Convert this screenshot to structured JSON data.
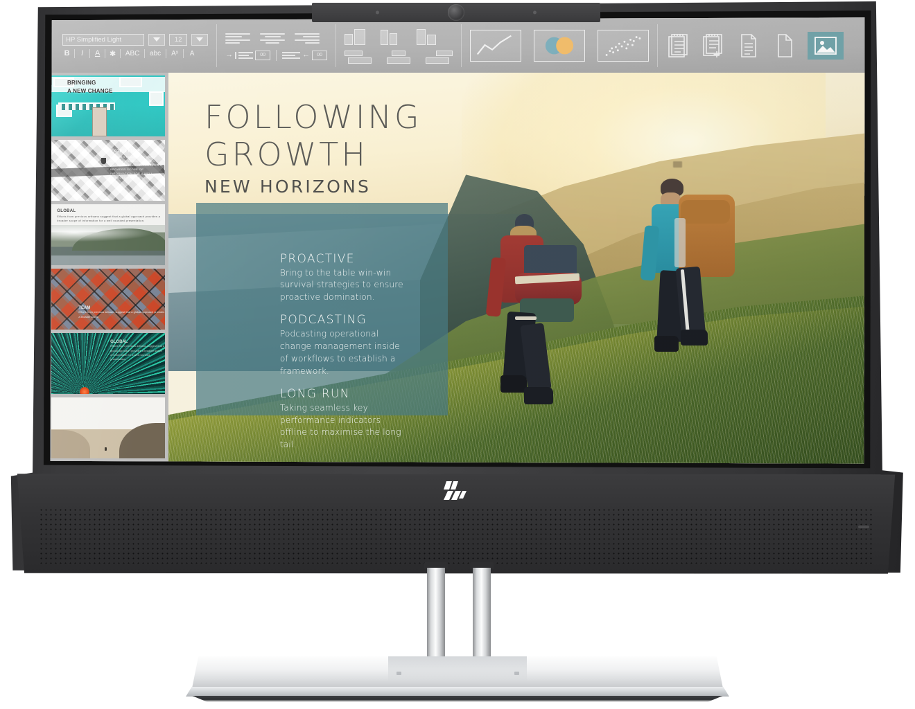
{
  "device": {
    "brand": "hp",
    "logo_name": "hp-logo",
    "webcam_name": "webcam"
  },
  "toolbar": {
    "font_name": "HP Simplified Light",
    "font_size": "12",
    "font_dropdown_label": "▼",
    "size_dropdown_label": "▼",
    "format_buttons": [
      {
        "name": "bold-button",
        "label": "B"
      },
      {
        "name": "italic-button",
        "label": "I"
      },
      {
        "name": "underline-button",
        "label": "A"
      },
      {
        "name": "text-color-button",
        "label": "A"
      }
    ],
    "case_buttons": [
      {
        "name": "uppercase-button",
        "label": "ABC"
      },
      {
        "name": "lowercase-button",
        "label": "abc"
      },
      {
        "name": "superscript-button",
        "label": "Aˣ"
      },
      {
        "name": "subscript-button",
        "label": "A"
      }
    ],
    "align_buttons": [
      {
        "name": "align-left-button",
        "label": "Align left"
      },
      {
        "name": "align-center-button",
        "label": "Align center"
      },
      {
        "name": "align-right-button",
        "label": "Align right"
      }
    ],
    "indent_buttons": [
      {
        "name": "indent-increase-button",
        "label": "Increase indent"
      },
      {
        "name": "indent-decrease-button",
        "label": "Decrease indent"
      }
    ],
    "indent_box_label": "00",
    "layout_buttons": [
      {
        "name": "layout-two-column-button",
        "label": "Two column"
      },
      {
        "name": "layout-split-button",
        "label": "Split"
      },
      {
        "name": "layout-sidebar-button",
        "label": "Sidebar"
      },
      {
        "name": "layout-caption-left-button",
        "label": "Caption left"
      },
      {
        "name": "layout-caption-center-button",
        "label": "Caption center"
      },
      {
        "name": "layout-caption-right-button",
        "label": "Caption right"
      }
    ],
    "chart_buttons": [
      {
        "name": "line-chart-button",
        "label": "Line chart"
      },
      {
        "name": "venn-chart-button",
        "label": "Venn chart"
      },
      {
        "name": "scatter-chart-button",
        "label": "Scatter chart"
      }
    ],
    "doc_buttons": [
      {
        "name": "notepad-button",
        "label": "Notepad"
      },
      {
        "name": "notepad-add-button",
        "label": "Add notepad"
      },
      {
        "name": "document-button",
        "label": "Document"
      },
      {
        "name": "blank-page-button",
        "label": "Blank page"
      }
    ],
    "image_button": {
      "name": "insert-image-button",
      "label": "Insert image",
      "active": true
    }
  },
  "colors": {
    "accent_teal": "#74a6ac",
    "panel_teal": "#487a82",
    "chart_blue": "#7fb0bd",
    "chart_orange": "#f2be6c",
    "toolbar_gray": "#b3b3b3",
    "headline_gray": "#5b5b57",
    "slide_cream": "#f6f1de"
  },
  "sidebar": {
    "thumbnails": [
      {
        "name": "slide-thumbnail-1",
        "title_line1": "BRINGING",
        "title_line2": "A NEW CHANGE",
        "theme": "turquoise-building"
      },
      {
        "name": "slide-thumbnail-2",
        "title": "EXCELLENCE",
        "body": "Efforts from previous artisans suggest that a global approach provides a broader scope of information for a well rounded presentation.",
        "theme": "geometric-grayscale"
      },
      {
        "name": "slide-thumbnail-3",
        "title": "GLOBAL",
        "body": "Efforts from previous artisans suggest that a global approach provides a broader scope of information for a well rounded presentation.",
        "theme": "misty-landscape"
      },
      {
        "name": "slide-thumbnail-4",
        "title": "TEAM",
        "body": "Efforts from previous artisans suggest that a global approach provides a broader scope.",
        "theme": "orange-diamonds"
      },
      {
        "name": "slide-thumbnail-5",
        "title": "GLOBAL",
        "body": "Efforts from previous artisans suggest that a global approach provides a broader scope of information for a well rounded presentation.",
        "theme": "green-burst"
      },
      {
        "name": "slide-thumbnail-6",
        "title": "",
        "body": "",
        "theme": "canyon-photo"
      }
    ]
  },
  "slide": {
    "headline_line1": "FOLLOWING",
    "headline_line2": "GROWTH",
    "subhead": "NEW HORIZONS",
    "photo_description": "Two hikers with backpacks walking up a sunlit grassy hillside at golden hour",
    "panel_sections": [
      {
        "name": "panel-section-proactive",
        "heading": "PROACTIVE",
        "body": "Bring to the table win-win survival strategies to ensure proactive domination."
      },
      {
        "name": "panel-section-podcasting",
        "heading": "PODCASTING",
        "body": "Podcasting operational change management inside of workflows to establish a framework."
      },
      {
        "name": "panel-section-long-run",
        "heading": "LONG RUN",
        "body": "Taking seamless key performance indicators offline to maximise the long tail."
      }
    ]
  }
}
